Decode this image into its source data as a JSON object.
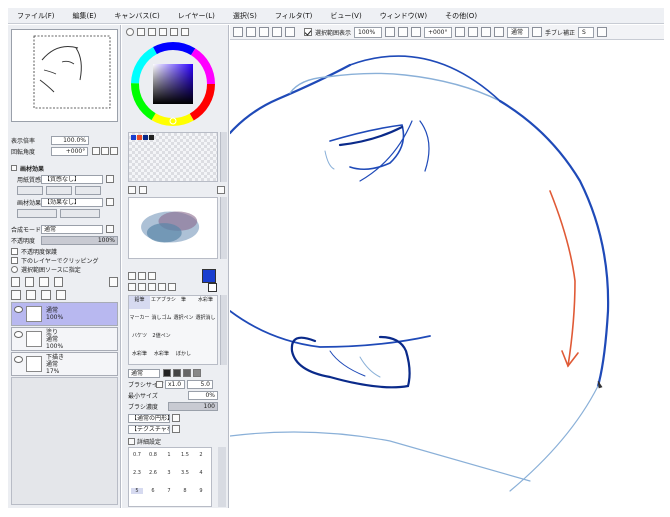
{
  "menubar": {
    "items": [
      "ファイル(F)",
      "編集(E)",
      "キャンバス(C)",
      "レイヤー(L)",
      "選択(S)",
      "フィルタ(T)",
      "ビュー(V)",
      "ウィンドウ(W)",
      "その他(O)"
    ]
  },
  "toolbar": {
    "selection_display_label": "選択範囲表示",
    "selection_display_checked": true,
    "zoom_value": "100%",
    "angle_value": "+000°",
    "mode_value": "通常",
    "stabilizer_label": "手ブレ補正",
    "stabilizer_value": "S"
  },
  "navigator": {
    "zoom_label": "表示倍率",
    "zoom_value": "100.0%",
    "rotate_label": "回転角度",
    "rotate_value": "+000°"
  },
  "paper_texture": {
    "section_label": "画材効果",
    "texture_label": "用紙質感",
    "texture_value": "【質感なし】",
    "effect_label": "画材効果",
    "effect_value": "【効果なし】"
  },
  "layer_props": {
    "blend_label": "合成モード",
    "blend_value": "通常",
    "opacity_label": "不透明度",
    "opacity_value": "100%",
    "protect_opacity_label": "不透明度保護",
    "clip_label": "下のレイヤーでクリッピング",
    "selection_source_label": "選択範囲ソースに指定"
  },
  "layers": [
    {
      "name": "通常",
      "mode": "100%",
      "selected": true
    },
    {
      "name": "塗り",
      "mode": "通常",
      "opacity": "100%",
      "selected": false
    },
    {
      "name": "下描き",
      "mode": "通常",
      "opacity": "17%",
      "selected": false
    }
  ],
  "colors": {
    "primary": "#1a3fd0",
    "swatches": [
      "#1a3fd0",
      "#e84a2a",
      "#0a2a8a",
      "#222222",
      "#ffffff"
    ],
    "stroke_blue": "#1f4ab8",
    "stroke_red": "#e05a36",
    "stroke_guide": "#8ab0d8"
  },
  "tools": {
    "rows": [
      [
        "鉛筆",
        "エアブラシ",
        "筆",
        "水彩筆"
      ],
      [
        "マーカー",
        "消しゴム",
        "選択ペン",
        "選択消し"
      ],
      [
        "バケツ",
        "2値ペン",
        "",
        ""
      ],
      [
        "水彩筆",
        "水彩筆",
        "ぼかし",
        ""
      ]
    ]
  },
  "brush_settings": {
    "mode_value": "通常",
    "size_label": "ブラシサイズ",
    "size_multiplier": "x1.0",
    "size_value": "5.0",
    "min_size_label": "最小サイズ",
    "min_size_value": "0%",
    "density_label": "ブラシ濃度",
    "density_value": "100",
    "shape_value": "【通常の円形】",
    "texture_value": "【テクスチャなし】",
    "advanced_label": "詳細設定"
  },
  "brush_sizes": {
    "rows": [
      [
        "0.7",
        "0.8",
        "1",
        "1.5",
        "2"
      ],
      [
        "2.3",
        "2.6",
        "3",
        "3.5",
        "4"
      ],
      [
        "5",
        "6",
        "7",
        "8",
        "9"
      ]
    ]
  }
}
